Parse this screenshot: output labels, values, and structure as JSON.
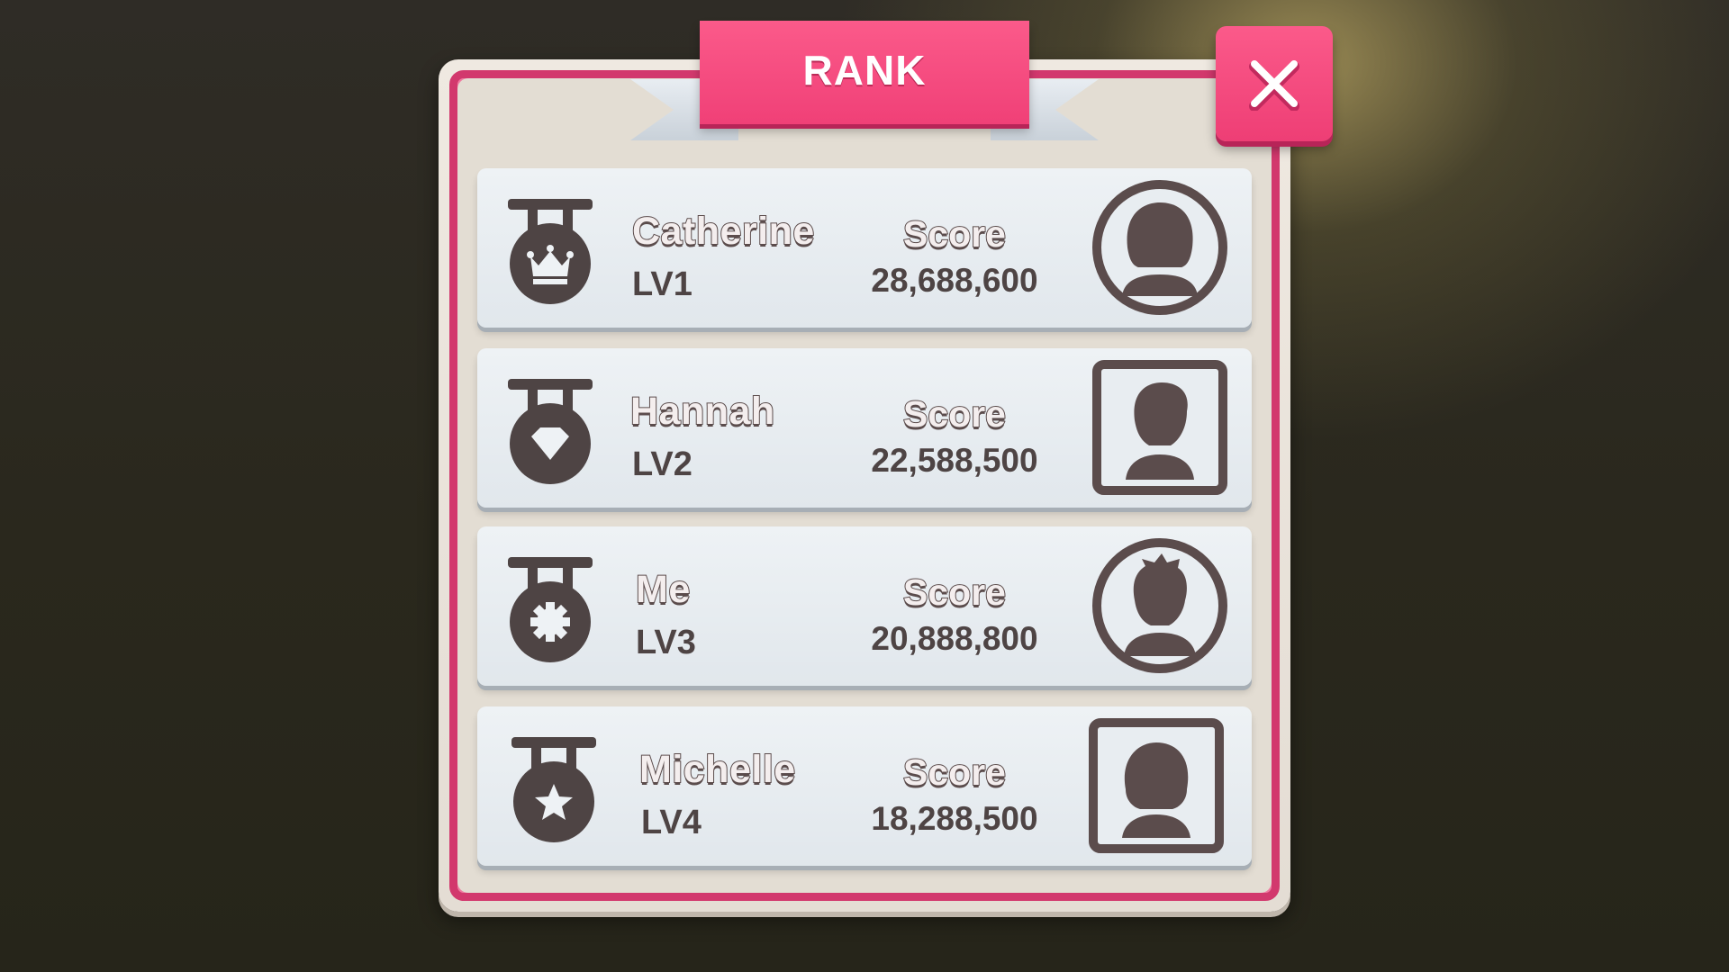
{
  "title": "RANK",
  "close_button": {
    "icon": "close-icon"
  },
  "colors": {
    "accent": "#f04077",
    "dark": "#4e4444",
    "panel": "#e3ddd3",
    "row": "#e8edf1"
  },
  "score_label": "Score",
  "players": [
    {
      "name": "Catherine",
      "level": "LV1",
      "score": "28,688,600",
      "medal_icon": "crown-medal-icon",
      "avatar_icon": "female-avatar-icon",
      "frame": "circle"
    },
    {
      "name": "Hannah",
      "level": "LV2",
      "score": "22,588,500",
      "medal_icon": "diamond-medal-icon",
      "avatar_icon": "male-avatar-icon",
      "frame": "square"
    },
    {
      "name": "Me",
      "level": "LV3",
      "score": "20,888,800",
      "medal_icon": "gear-medal-icon",
      "avatar_icon": "spiky-hair-avatar-icon",
      "frame": "circle"
    },
    {
      "name": "Michelle",
      "level": "LV4",
      "score": "18,288,500",
      "medal_icon": "star-medal-icon",
      "avatar_icon": "female-avatar-icon",
      "frame": "square"
    }
  ]
}
